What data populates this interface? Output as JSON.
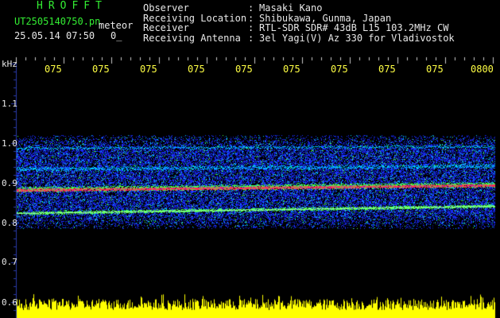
{
  "header": {
    "logo": "HROFFT",
    "filename": "UT2505140750.pn",
    "meteor_label": "meteor",
    "datetime": "25.05.14 07:50",
    "count": "0_"
  },
  "station": {
    "rows": [
      {
        "key": "Observer",
        "sep": ":",
        "value": "Masaki Kano"
      },
      {
        "key": "Receiving Location",
        "sep": ":",
        "value": "Shibukawa, Gunma, Japan"
      },
      {
        "key": "Receiver",
        "sep": ":",
        "value": "RTL-SDR SDR# 43dB L15 103.2MHz CW"
      },
      {
        "key": "Receiving Antenna",
        "sep": ":",
        "value": "3el Yagi(V) Az 330 for Vladivostok"
      }
    ]
  },
  "spectrogram": {
    "y_unit": "kHz",
    "y_ticks": [
      "1.1",
      "1.0",
      "0.9",
      "0.8",
      "0.7",
      "0.6"
    ],
    "x_ticks": [
      "075",
      "075",
      "075",
      "075",
      "075",
      "075",
      "075",
      "075",
      "075",
      "0800"
    ],
    "colors": {
      "background": "#000000",
      "noise_blue": "#1a2cff",
      "noise_cyan": "#00d0ff",
      "carrier_red": "#ff2a5a",
      "carrier_green": "#4cff4c",
      "grid": "#2a3aa8",
      "amplitude": "#ffff00"
    }
  }
}
